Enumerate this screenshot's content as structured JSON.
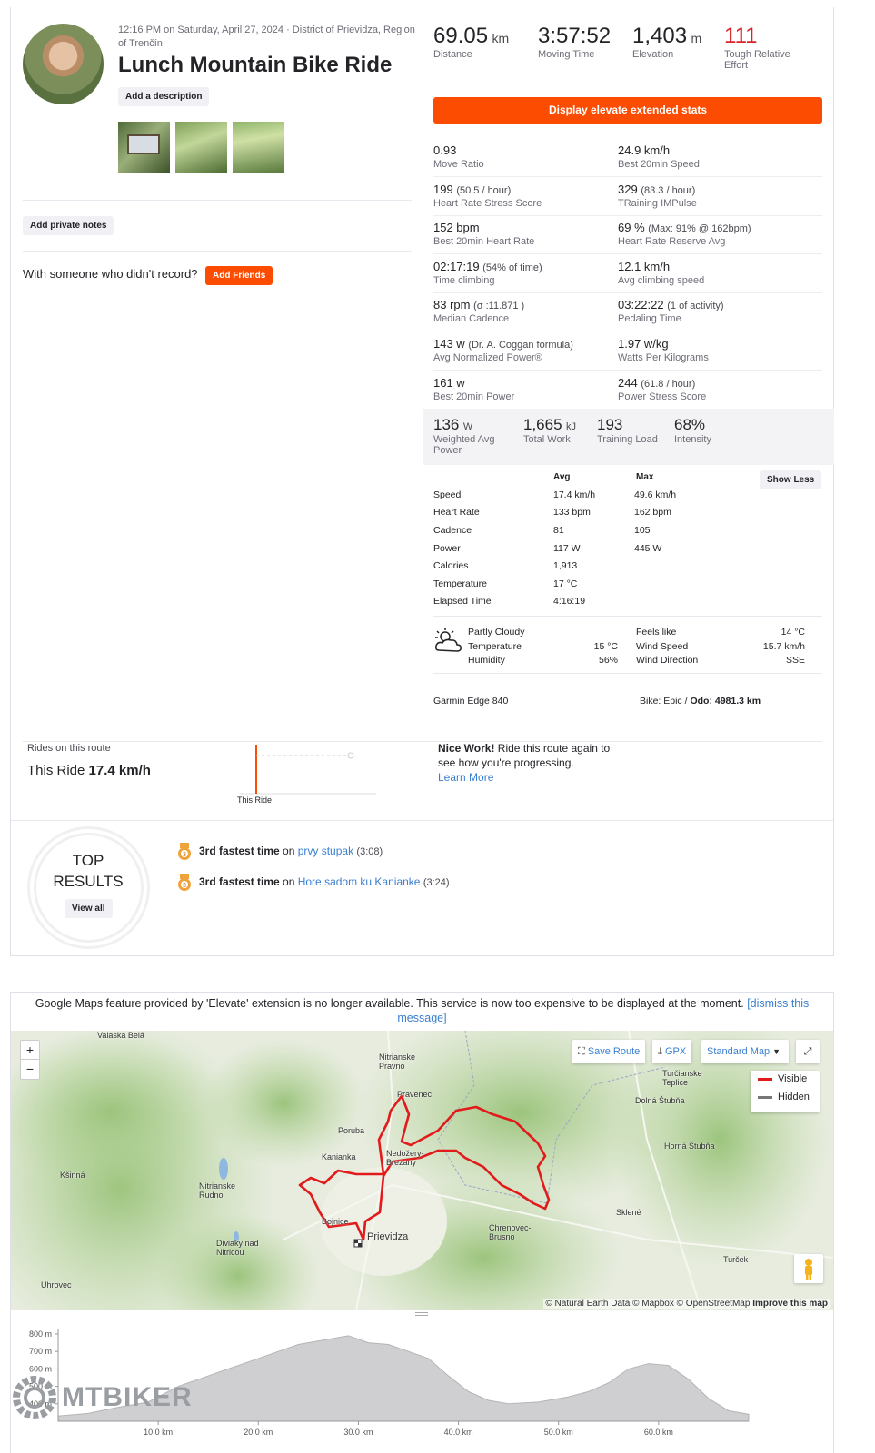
{
  "header": {
    "datetime": "12:16 PM on Saturday, April 27, 2024 · District of Prievidza, Region of Trenčín",
    "title": "Lunch Mountain Bike Ride",
    "add_description": "Add a description",
    "add_private_notes": "Add private notes",
    "with_someone": "With someone who didn't record?",
    "add_friends": "Add Friends"
  },
  "primary_stats": [
    {
      "value": "69.05",
      "unit": "km",
      "label": "Distance"
    },
    {
      "value": "3:57:52",
      "unit": "",
      "label": "Moving Time"
    },
    {
      "value": "1,403",
      "unit": "m",
      "label": "Elevation"
    },
    {
      "value": "111",
      "unit": "",
      "label": "Tough Relative Effort"
    }
  ],
  "elevate_button": "Display elevate extended stats",
  "extended": [
    {
      "l": {
        "v": "0.93",
        "s": "",
        "lab": "Move Ratio"
      },
      "r": {
        "v": "24.9 km/h",
        "s": "",
        "lab": "Best 20min Speed"
      }
    },
    {
      "l": {
        "v": "199",
        "s": "(50.5 / hour)",
        "lab": "Heart Rate Stress Score"
      },
      "r": {
        "v": "329",
        "s": "(83.3 / hour)",
        "lab": "TRaining IMPulse"
      }
    },
    {
      "l": {
        "v": "152 bpm",
        "s": "",
        "lab": "Best 20min Heart Rate"
      },
      "r": {
        "v": "69 %",
        "s": "(Max: 91% @ 162bpm)",
        "lab": "Heart Rate Reserve Avg"
      }
    },
    {
      "l": {
        "v": "02:17:19",
        "s": "(54% of time)",
        "lab": "Time climbing"
      },
      "r": {
        "v": "12.1 km/h",
        "s": "",
        "lab": "Avg climbing speed"
      }
    },
    {
      "l": {
        "v": "83 rpm",
        "s": "(σ :11.871 )",
        "lab": "Median Cadence"
      },
      "r": {
        "v": "03:22:22",
        "s": "(1 of activity)",
        "lab": "Pedaling Time"
      }
    },
    {
      "l": {
        "v": "143 w",
        "s": "(Dr. A. Coggan formula)",
        "lab": "Avg Normalized Power®"
      },
      "r": {
        "v": "1.97 w/kg",
        "s": "",
        "lab": "Watts Per Kilograms"
      }
    },
    {
      "l": {
        "v": "161 w",
        "s": "",
        "lab": "Best 20min Power"
      },
      "r": {
        "v": "244",
        "s": "(61.8 / hour)",
        "lab": "Power Stress Score"
      }
    }
  ],
  "power_stats": [
    {
      "value": "136",
      "unit": "W",
      "label": "Weighted Avg Power"
    },
    {
      "value": "1,665",
      "unit": "kJ",
      "label": "Total Work"
    },
    {
      "value": "193",
      "unit": "",
      "label": "Training Load"
    },
    {
      "value": "68%",
      "unit": "",
      "label": "Intensity"
    }
  ],
  "table": {
    "avg_header": "Avg",
    "max_header": "Max",
    "show_less": "Show Less",
    "rows": [
      {
        "name": "Speed",
        "avg": "17.4 km/h",
        "max": "49.6 km/h"
      },
      {
        "name": "Heart Rate",
        "avg": "133 bpm",
        "max": "162 bpm"
      },
      {
        "name": "Cadence",
        "avg": "81",
        "max": "105"
      },
      {
        "name": "Power",
        "avg": "117 W",
        "max": "445 W"
      },
      {
        "name": "Calories",
        "avg": "1,913",
        "max": ""
      },
      {
        "name": "Temperature",
        "avg": "17 °C",
        "max": ""
      },
      {
        "name": "Elapsed Time",
        "avg": "4:16:19",
        "max": ""
      }
    ]
  },
  "weather": {
    "condition": "Partly Cloudy",
    "temp_label": "Temperature",
    "temp": "15 °C",
    "humidity_label": "Humidity",
    "humidity": "56%",
    "feels_label": "Feels like",
    "feels": "14 °C",
    "wind_label": "Wind Speed",
    "wind": "15.7 km/h",
    "dir_label": "Wind Direction",
    "dir": "SSE"
  },
  "device": "Garmin Edge 840",
  "bike_prefix": "Bike: Epic / ",
  "bike_odo": "Odo: 4981.3 km",
  "route": {
    "title": "Rides on this route",
    "this_ride": "This Ride",
    "speed": "17.4 km/h",
    "chart_label": "This Ride",
    "nice_bold": "Nice Work!",
    "nice_text": " Ride this route again to see how you're progressing.",
    "learn_more": "Learn More"
  },
  "top_results": {
    "title1": "TOP",
    "title2": "RESULTS",
    "view_all": "View all",
    "items": [
      {
        "bold": "3rd fastest time",
        "on": " on ",
        "segment": "prvy stupak",
        "time": "(3:08)"
      },
      {
        "bold": "3rd fastest time",
        "on": " on ",
        "segment": "Hore sadom ku Kanianke",
        "time": "(3:24)"
      }
    ]
  },
  "map": {
    "notice": "Google Maps feature provided by 'Elevate' extension is no longer available. This service is now too expensive to be displayed at the moment.",
    "dismiss": "[dismiss this message]",
    "save_route": "Save Route",
    "gpx": "GPX",
    "standard_map": "Standard Map",
    "legend_visible": "Visible",
    "legend_hidden": "Hidden",
    "zoom_in": "+",
    "zoom_out": "−",
    "attribution": "© Natural Earth Data © Mapbox © OpenStreetMap",
    "improve": "Improve this map",
    "places": [
      "Valaská Belá",
      "Nitrianske Pravno",
      "Pravenec",
      "Turčianske Teplice",
      "Dolná Štubňa",
      "Poruba",
      "Kanianka",
      "Nedožery-Brezany",
      "Horná Štubňa",
      "Kšinná",
      "Nitrianske Rudno",
      "Bojnice",
      "Prievidza",
      "Chrenovec-Brusno",
      "Sklené",
      "Diviaky nad Nitricou",
      "Turček",
      "Uhrovec"
    ]
  },
  "chart_data": {
    "type": "area",
    "ylabel": "",
    "y_ticks": [
      "800 m",
      "700 m",
      "600 m",
      "500 m",
      "400 m"
    ],
    "x_ticks": [
      "10.0 km",
      "20.0 km",
      "30.0 km",
      "40.0 km",
      "50.0 km",
      "60.0 km"
    ],
    "ylim": [
      300,
      800
    ],
    "xlim": [
      0,
      69
    ],
    "x": [
      0,
      3,
      6,
      9,
      12,
      15,
      18,
      21,
      24,
      27,
      29,
      31,
      33,
      35,
      37,
      39,
      41,
      43,
      45,
      48,
      51,
      53,
      55,
      57,
      59,
      61,
      63,
      65,
      67,
      69
    ],
    "y": [
      330,
      345,
      380,
      410,
      500,
      560,
      620,
      680,
      740,
      770,
      790,
      750,
      740,
      700,
      660,
      560,
      470,
      420,
      400,
      410,
      440,
      470,
      520,
      600,
      630,
      620,
      540,
      430,
      360,
      340
    ]
  },
  "watermark": "MTBIKER"
}
